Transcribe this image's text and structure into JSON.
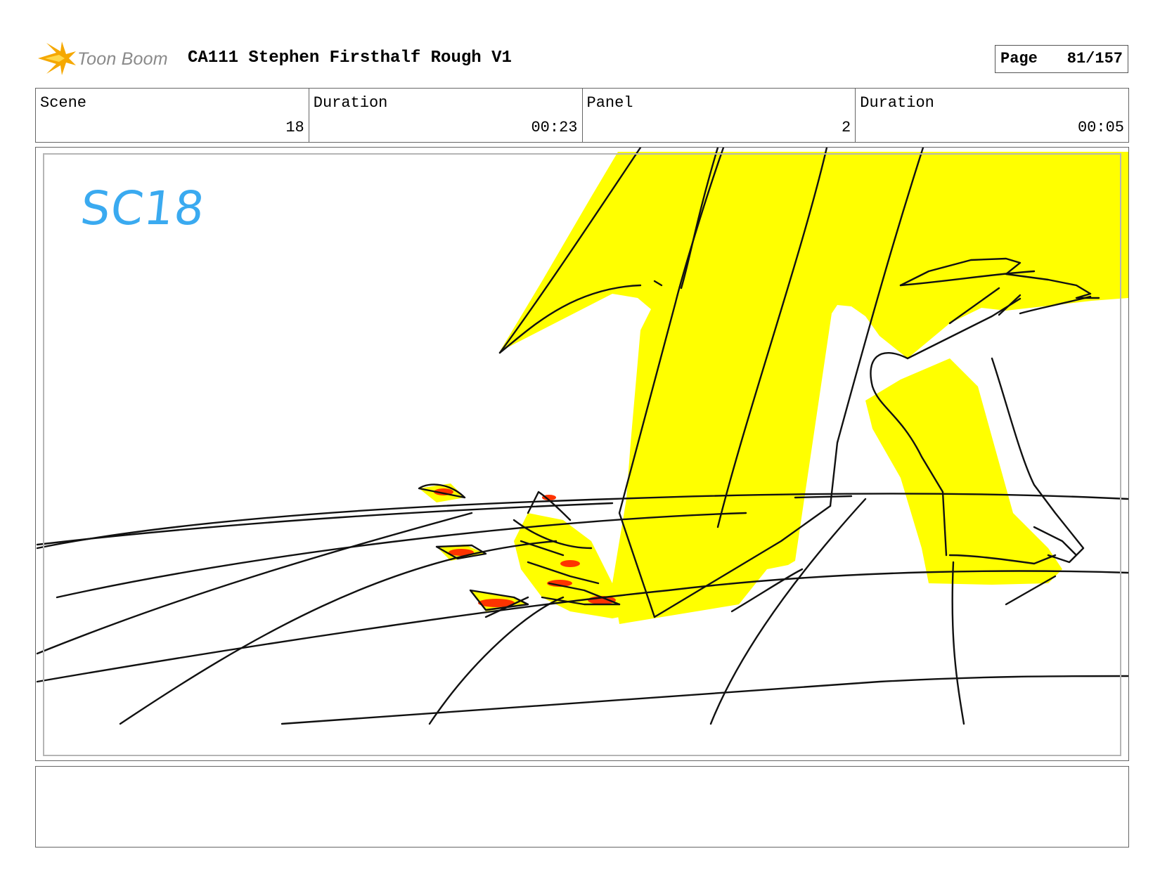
{
  "header": {
    "logo_text": "Toon Boom",
    "title": "CA111 Stephen Firsthalf Rough V1",
    "page_label": "Page",
    "page_value": "81/157"
  },
  "info": {
    "scene_label": "Scene",
    "scene_value": "18",
    "scene_duration_label": "Duration",
    "scene_duration_value": "00:23",
    "panel_label": "Panel",
    "panel_value": "2",
    "panel_duration_label": "Duration",
    "panel_duration_value": "00:05"
  },
  "panel": {
    "scene_tag": "SC18"
  },
  "colors": {
    "fill_yellow": "#ffff00",
    "flame_red": "#ff3300",
    "ink": "#111111",
    "scene_tag_blue": "#3aaaf0",
    "logo_orange": "#f5a800"
  },
  "notes": {
    "text": ""
  }
}
